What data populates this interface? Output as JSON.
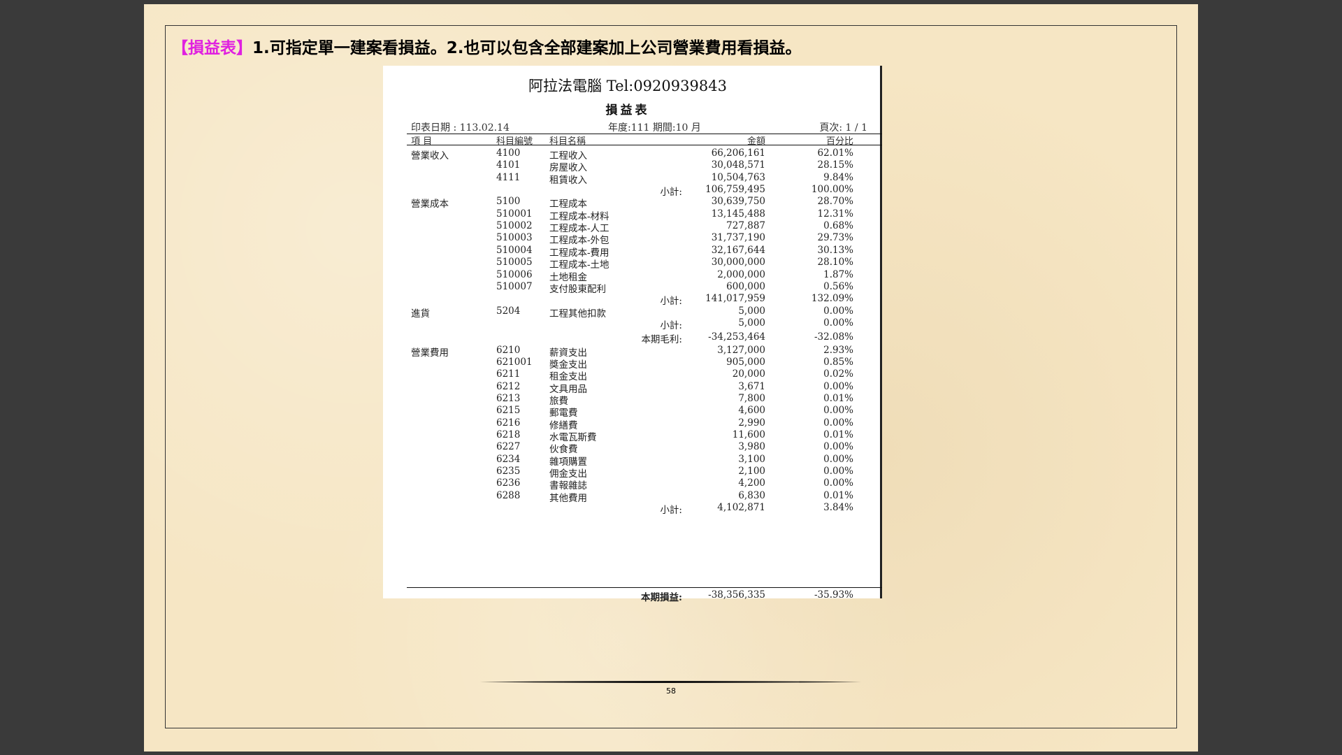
{
  "caption": {
    "tag": "【損益表】",
    "text": "1.可指定單一建案看損益。2.也可以包含全部建案加上公司營業費用看損益。"
  },
  "report": {
    "company": "阿拉法電腦 Tel:0920939843",
    "title": "損益表",
    "print_date": "印表日期 : 113.02.14",
    "period": "年度:111 期間:10 月",
    "page": "頁次: 1 / 1",
    "headers": {
      "item": "項 目",
      "code": "科目編號",
      "name": "科目名稱",
      "amount": "金額",
      "percent": "百分比"
    },
    "rows": [
      {
        "item": "營業收入",
        "code": "4100",
        "name": "工程收入",
        "label": "",
        "amount": "66,206,161",
        "percent": "62.01%"
      },
      {
        "item": "",
        "code": "4101",
        "name": "房屋收入",
        "label": "",
        "amount": "30,048,571",
        "percent": "28.15%"
      },
      {
        "item": "",
        "code": "4111",
        "name": "租賃收入",
        "label": "",
        "amount": "10,504,763",
        "percent": "9.84%"
      },
      {
        "item": "",
        "code": "",
        "name": "",
        "label": "小計:",
        "amount": "106,759,495",
        "percent": "100.00%"
      },
      {
        "item": "營業成本",
        "code": "5100",
        "name": "工程成本",
        "label": "",
        "amount": "30,639,750",
        "percent": "28.70%"
      },
      {
        "item": "",
        "code": "510001",
        "name": "工程成本-材料",
        "label": "",
        "amount": "13,145,488",
        "percent": "12.31%"
      },
      {
        "item": "",
        "code": "510002",
        "name": "工程成本-人工",
        "label": "",
        "amount": "727,887",
        "percent": "0.68%"
      },
      {
        "item": "",
        "code": "510003",
        "name": "工程成本-外包",
        "label": "",
        "amount": "31,737,190",
        "percent": "29.73%"
      },
      {
        "item": "",
        "code": "510004",
        "name": "工程成本-費用",
        "label": "",
        "amount": "32,167,644",
        "percent": "30.13%"
      },
      {
        "item": "",
        "code": "510005",
        "name": "工程成本-土地",
        "label": "",
        "amount": "30,000,000",
        "percent": "28.10%"
      },
      {
        "item": "",
        "code": "510006",
        "name": "土地租金",
        "label": "",
        "amount": "2,000,000",
        "percent": "1.87%"
      },
      {
        "item": "",
        "code": "510007",
        "name": "支付股東配利",
        "label": "",
        "amount": "600,000",
        "percent": "0.56%"
      },
      {
        "item": "",
        "code": "",
        "name": "",
        "label": "小計:",
        "amount": "141,017,959",
        "percent": "132.09%"
      },
      {
        "item": "進貨",
        "code": "5204",
        "name": "工程其他扣款",
        "label": "",
        "amount": "5,000",
        "percent": "0.00%"
      },
      {
        "item": "",
        "code": "",
        "name": "",
        "label": "小計:",
        "amount": "5,000",
        "percent": "0.00%"
      },
      {
        "item": "",
        "code": "",
        "name": "",
        "label": "本期毛利:",
        "amount": "-34,253,464",
        "percent": "-32.08%"
      },
      {
        "item": "營業費用",
        "code": "6210",
        "name": "薪資支出",
        "label": "",
        "amount": "3,127,000",
        "percent": "2.93%"
      },
      {
        "item": "",
        "code": "621001",
        "name": "獎金支出",
        "label": "",
        "amount": "905,000",
        "percent": "0.85%"
      },
      {
        "item": "",
        "code": "6211",
        "name": "租金支出",
        "label": "",
        "amount": "20,000",
        "percent": "0.02%"
      },
      {
        "item": "",
        "code": "6212",
        "name": "文具用品",
        "label": "",
        "amount": "3,671",
        "percent": "0.00%"
      },
      {
        "item": "",
        "code": "6213",
        "name": "旅費",
        "label": "",
        "amount": "7,800",
        "percent": "0.01%"
      },
      {
        "item": "",
        "code": "6215",
        "name": "郵電費",
        "label": "",
        "amount": "4,600",
        "percent": "0.00%"
      },
      {
        "item": "",
        "code": "6216",
        "name": "修繕費",
        "label": "",
        "amount": "2,990",
        "percent": "0.00%"
      },
      {
        "item": "",
        "code": "6218",
        "name": "水電瓦斯費",
        "label": "",
        "amount": "11,600",
        "percent": "0.01%"
      },
      {
        "item": "",
        "code": "6227",
        "name": "伙食費",
        "label": "",
        "amount": "3,980",
        "percent": "0.00%"
      },
      {
        "item": "",
        "code": "6234",
        "name": "雜項購置",
        "label": "",
        "amount": "3,100",
        "percent": "0.00%"
      },
      {
        "item": "",
        "code": "6235",
        "name": "佣金支出",
        "label": "",
        "amount": "2,100",
        "percent": "0.00%"
      },
      {
        "item": "",
        "code": "6236",
        "name": "書報雜誌",
        "label": "",
        "amount": "4,200",
        "percent": "0.00%"
      },
      {
        "item": "",
        "code": "6288",
        "name": "其他費用",
        "label": "",
        "amount": "6,830",
        "percent": "0.01%"
      },
      {
        "item": "",
        "code": "",
        "name": "",
        "label": "小計:",
        "amount": "4,102,871",
        "percent": "3.84%"
      }
    ],
    "total": {
      "label": "本期損益:",
      "amount": "-38,356,335",
      "percent": "-35.93%"
    }
  },
  "footer": {
    "page_number": "58"
  }
}
